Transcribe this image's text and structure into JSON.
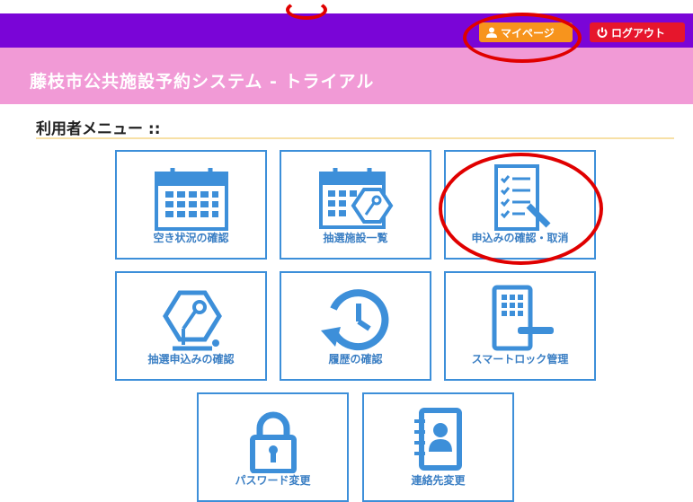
{
  "topbar": {
    "mypage_label": "マイページ",
    "logout_label": "ログアウト"
  },
  "header": {
    "title": "藤枝市公共施設予約システム - トライアル"
  },
  "menu": {
    "title": "利用者メニュー ::",
    "tiles": [
      {
        "label": "空き状況の確認",
        "icon": "calendar-icon"
      },
      {
        "label": "抽選施設一覧",
        "icon": "lottery-calendar-icon"
      },
      {
        "label": "申込みの確認・取消",
        "icon": "checklist-icon"
      },
      {
        "label": "抽選申込みの確認",
        "icon": "lottery-icon"
      },
      {
        "label": "履歴の確認",
        "icon": "history-icon"
      },
      {
        "label": "スマートロック管理",
        "icon": "smart-lock-icon"
      },
      {
        "label": "パスワード変更",
        "icon": "padlock-icon"
      },
      {
        "label": "連絡先変更",
        "icon": "address-book-icon"
      }
    ]
  },
  "colors": {
    "topbar": "#7a05d7",
    "header": "#f19ad6",
    "mypage": "#f7941d",
    "logout": "#e6162c",
    "tile_border": "#3d8fd9",
    "annotation": "#e00000"
  }
}
